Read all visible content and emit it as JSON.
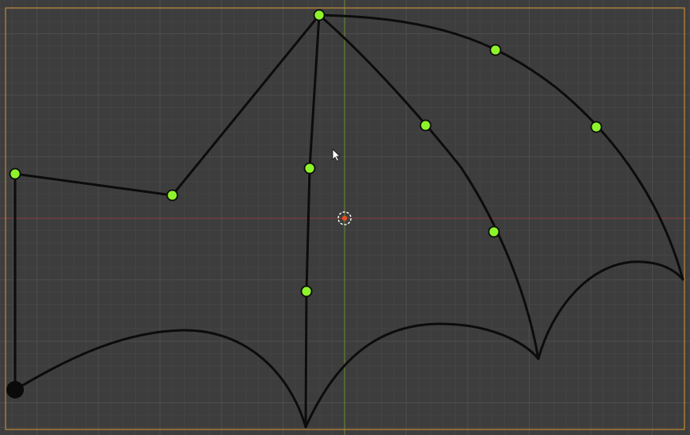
{
  "app": {
    "editor": "3d-viewport",
    "view": "top-orthographic",
    "background_color": "#3d3d3d"
  },
  "colors": {
    "grid_minor": "#444444",
    "grid_major": "#4d4d4d",
    "x_axis": "#8a3b44",
    "y_axis": "#6a8c36",
    "camera_frame": "#c08a3a",
    "curve": "#0c0c0c",
    "control_point_fill": "#8ef42a",
    "control_point_stroke": "#0c0c0c",
    "selected_point": "#0a0a0a",
    "origin_outer": "#ffffff",
    "origin_inner": "#e05020"
  },
  "icons": {
    "origin": "object-origin-icon",
    "cursor": "mouse-pointer-icon"
  },
  "object": {
    "type": "bezier-curve",
    "shape": "bat-wing",
    "control_point_count": 10,
    "selected_point_count": 1
  }
}
